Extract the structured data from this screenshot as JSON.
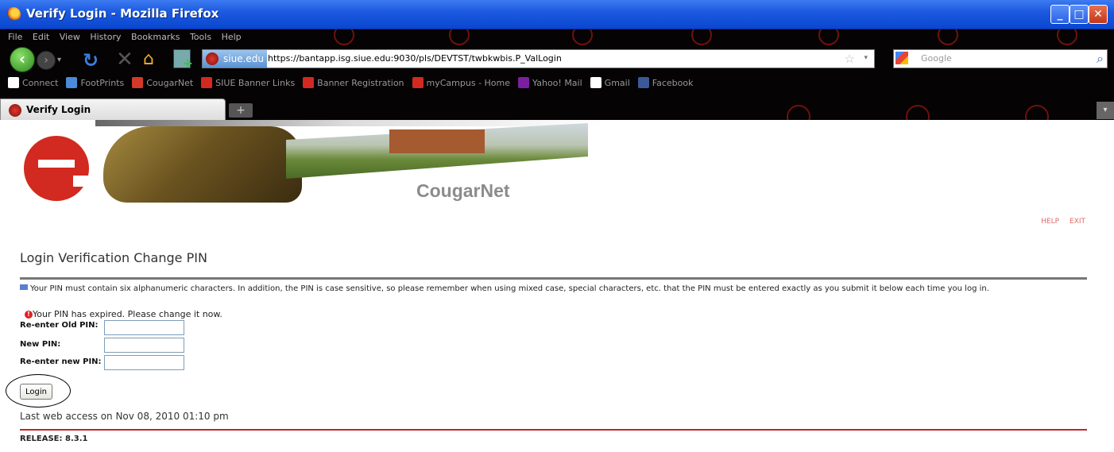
{
  "window": {
    "title": "Verify Login - Mozilla Firefox",
    "buttons": {
      "minimize": "_",
      "maximize": "□",
      "close": "✕"
    }
  },
  "menu": [
    "File",
    "Edit",
    "View",
    "History",
    "Bookmarks",
    "Tools",
    "Help"
  ],
  "navbar": {
    "site_identity": "siue.edu",
    "url": "https://bantapp.isg.siue.edu:9030/pls/DEVTST/twbkwbis.P_ValLogin",
    "search_placeholder": "Google"
  },
  "bookmarks": [
    {
      "label": "Connect",
      "icon": "page-icon",
      "color": "#ffffff"
    },
    {
      "label": "FootPrints",
      "icon": "footprints-icon",
      "color": "#4a8ad8"
    },
    {
      "label": "CougarNet",
      "icon": "cougarnet-icon",
      "color": "#d2392a"
    },
    {
      "label": "SIUE Banner Links",
      "icon": "e-logo-icon",
      "color": "#d22a20"
    },
    {
      "label": "Banner Registration",
      "icon": "e-logo-icon",
      "color": "#d22a20"
    },
    {
      "label": "myCampus - Home",
      "icon": "mycampus-icon",
      "color": "#d22a20"
    },
    {
      "label": "Yahoo! Mail",
      "icon": "yahoo-icon",
      "color": "#7b1fa2"
    },
    {
      "label": "Gmail",
      "icon": "page-icon",
      "color": "#ffffff"
    },
    {
      "label": "Facebook",
      "icon": "facebook-icon",
      "color": "#3b5998"
    }
  ],
  "tabs": [
    {
      "label": "Verify Login",
      "active": true
    }
  ],
  "page": {
    "brand": "CougarNet",
    "help_link": "HELP",
    "exit_link": "EXIT",
    "title": "Login Verification Change PIN",
    "info": "Your PIN must contain six alphanumeric characters. In addition, the PIN is case sensitive, so please remember when using mixed case, special characters, etc. that the PIN must be entered exactly as you submit it below each time you log in.",
    "error": "Your PIN has expired. Please change it now.",
    "fields": [
      {
        "label": "Re-enter Old PIN:",
        "value": ""
      },
      {
        "label": "New PIN:",
        "value": ""
      },
      {
        "label": "Re-enter new PIN:",
        "value": ""
      }
    ],
    "login_button": "Login",
    "last_access": "Last web access on Nov 08, 2010 01:10 pm",
    "release": "RELEASE: 8.3.1"
  },
  "colors": {
    "titlebar_blue": "#1c5ae0",
    "error_red": "#dd2222",
    "footer_rule": "#c0262a",
    "help_links": "#e06a6a"
  }
}
